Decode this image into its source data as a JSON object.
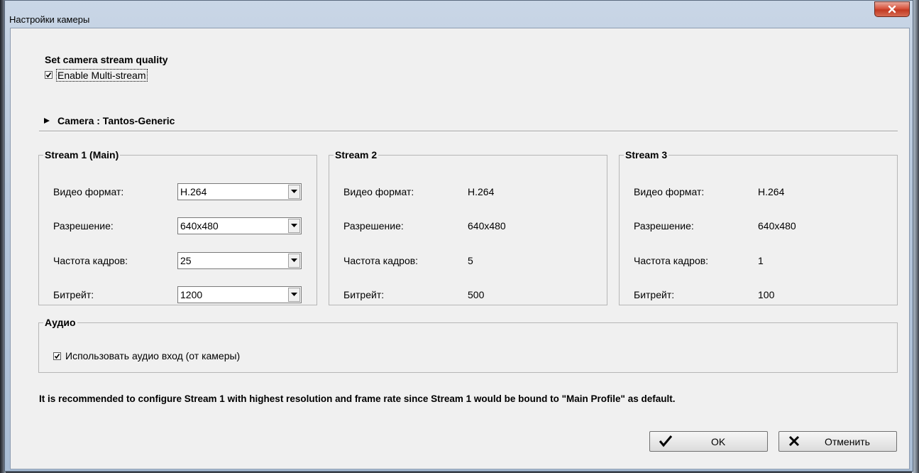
{
  "window": {
    "title": "Настройки камеры"
  },
  "quality": {
    "heading": "Set camera stream quality",
    "multistream_label": "Enable Multi-stream",
    "multistream_checked": true
  },
  "camera": {
    "label": "Camera : Tantos-Generic",
    "expander_icon": "triangle-right-icon"
  },
  "stream_labels": {
    "format": "Видео формат:",
    "resolution": "Разрешение:",
    "framerate": "Частота кадров:",
    "bitrate": "Битрейт:"
  },
  "streams": [
    {
      "title": "Stream 1 (Main)",
      "format": "H.264",
      "resolution": "640x480",
      "framerate": "25",
      "bitrate": "1200",
      "editable": true
    },
    {
      "title": "Stream 2",
      "format": "H.264",
      "resolution": "640x480",
      "framerate": "5",
      "bitrate": "500",
      "editable": false
    },
    {
      "title": "Stream 3",
      "format": "H.264",
      "resolution": "640x480",
      "framerate": "1",
      "bitrate": "100",
      "editable": false
    }
  ],
  "audio": {
    "title": "Аудио",
    "checkbox_label": "Использовать аудио вход (от камеры)",
    "checked": true
  },
  "note": "It is recommended to configure Stream 1 with highest resolution and frame rate since Stream 1 would be bound to \"Main Profile\" as default.",
  "buttons": {
    "ok": "OK",
    "cancel": "Отменить"
  },
  "colors": {
    "title_bar": "#b6c7dc",
    "client_bg": "#f0f0f0",
    "close_button": "#c23a22"
  }
}
